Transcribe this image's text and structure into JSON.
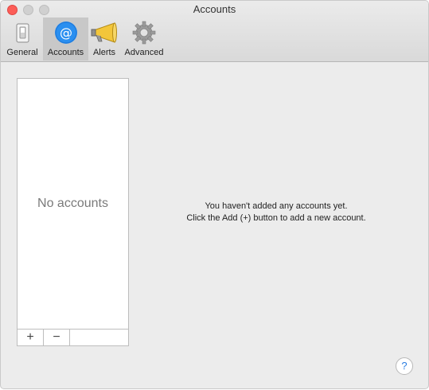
{
  "window": {
    "title": "Accounts"
  },
  "toolbar": {
    "tabs": [
      {
        "label": "General",
        "icon": "switch-icon"
      },
      {
        "label": "Accounts",
        "icon": "at-sign-icon",
        "selected": true
      },
      {
        "label": "Alerts",
        "icon": "megaphone-icon"
      },
      {
        "label": "Advanced",
        "icon": "gear-icon"
      }
    ]
  },
  "accounts_list": {
    "empty_text": "No accounts",
    "add_label": "+",
    "remove_label": "−"
  },
  "main": {
    "line1": "You haven't added any accounts yet.",
    "line2": "Click the Add (+) button to add a new account."
  },
  "help": {
    "label": "?"
  },
  "colors": {
    "accent": "#2a7de1",
    "close": "#fc5d57",
    "selected_tab": "#c8c8c8"
  }
}
